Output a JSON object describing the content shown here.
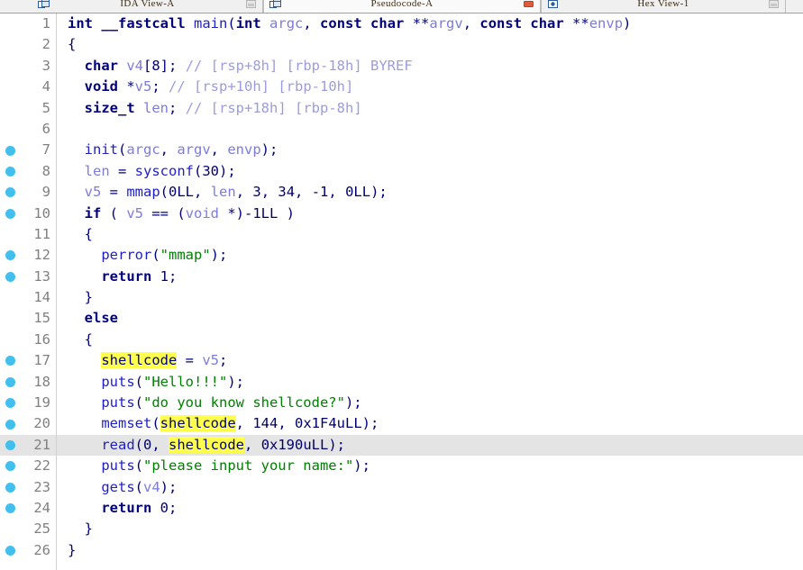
{
  "tabs": [
    {
      "label": "IDA View-A",
      "active": false,
      "icon": "window-icon",
      "button": "restore-icon",
      "button_color": "#c8c8c8"
    },
    {
      "label": "Pseudocode-A",
      "active": true,
      "icon": "window-icon",
      "button": "close-icon",
      "button_color": "#e05a3c"
    },
    {
      "label": "Hex View-1",
      "active": false,
      "icon": "hexview-icon",
      "button": "restore-icon",
      "button_color": "#c8c8c8"
    }
  ],
  "editor": {
    "highlight_word": "shellcode",
    "cursor_line": 21,
    "colors": {
      "breakpoint": "#41c0ef",
      "highlight_bg": "#ffff4d",
      "cursor_row_bg": "#e4e4e4",
      "string": "#008000",
      "comment": "#9c9cdc",
      "variable": "#7c7cdc",
      "function": "#2020c8",
      "keyword": "#00007f",
      "linenumber": "#808080"
    },
    "lines": [
      {
        "n": 1,
        "bp": false,
        "tokens": [
          {
            "c": "t-kw",
            "t": "int"
          },
          {
            "c": "t-plain",
            "t": " "
          },
          {
            "c": "t-kw",
            "t": "__fastcall"
          },
          {
            "c": "t-plain",
            "t": " "
          },
          {
            "c": "t-fn",
            "t": "main"
          },
          {
            "c": "t-punct",
            "t": "("
          },
          {
            "c": "t-kw",
            "t": "int"
          },
          {
            "c": "t-plain",
            "t": " "
          },
          {
            "c": "t-var",
            "t": "argc"
          },
          {
            "c": "t-punct",
            "t": ", "
          },
          {
            "c": "t-kw",
            "t": "const"
          },
          {
            "c": "t-plain",
            "t": " "
          },
          {
            "c": "t-kw",
            "t": "char"
          },
          {
            "c": "t-plain",
            "t": " **"
          },
          {
            "c": "t-var",
            "t": "argv"
          },
          {
            "c": "t-punct",
            "t": ", "
          },
          {
            "c": "t-kw",
            "t": "const"
          },
          {
            "c": "t-plain",
            "t": " "
          },
          {
            "c": "t-kw",
            "t": "char"
          },
          {
            "c": "t-plain",
            "t": " **"
          },
          {
            "c": "t-var",
            "t": "envp"
          },
          {
            "c": "t-punct",
            "t": ")"
          }
        ]
      },
      {
        "n": 2,
        "bp": false,
        "tokens": [
          {
            "c": "t-punct",
            "t": "{"
          }
        ]
      },
      {
        "n": 3,
        "bp": false,
        "tokens": [
          {
            "c": "t-plain",
            "t": "  "
          },
          {
            "c": "t-kw",
            "t": "char"
          },
          {
            "c": "t-plain",
            "t": " "
          },
          {
            "c": "t-var",
            "t": "v4"
          },
          {
            "c": "t-punct",
            "t": "[8]; "
          },
          {
            "c": "t-cmt",
            "t": "// [rsp+8h] [rbp-18h] BYREF"
          }
        ]
      },
      {
        "n": 4,
        "bp": false,
        "tokens": [
          {
            "c": "t-plain",
            "t": "  "
          },
          {
            "c": "t-kw",
            "t": "void"
          },
          {
            "c": "t-plain",
            "t": " *"
          },
          {
            "c": "t-var",
            "t": "v5"
          },
          {
            "c": "t-punct",
            "t": "; "
          },
          {
            "c": "t-cmt",
            "t": "// [rsp+10h] [rbp-10h]"
          }
        ]
      },
      {
        "n": 5,
        "bp": false,
        "tokens": [
          {
            "c": "t-plain",
            "t": "  "
          },
          {
            "c": "t-kw",
            "t": "size_t"
          },
          {
            "c": "t-plain",
            "t": " "
          },
          {
            "c": "t-var",
            "t": "len"
          },
          {
            "c": "t-punct",
            "t": "; "
          },
          {
            "c": "t-cmt",
            "t": "// [rsp+18h] [rbp-8h]"
          }
        ]
      },
      {
        "n": 6,
        "bp": false,
        "tokens": [
          {
            "c": "t-plain",
            "t": ""
          }
        ]
      },
      {
        "n": 7,
        "bp": true,
        "tokens": [
          {
            "c": "t-plain",
            "t": "  "
          },
          {
            "c": "t-fn",
            "t": "init"
          },
          {
            "c": "t-punct",
            "t": "("
          },
          {
            "c": "t-var",
            "t": "argc"
          },
          {
            "c": "t-punct",
            "t": ", "
          },
          {
            "c": "t-var",
            "t": "argv"
          },
          {
            "c": "t-punct",
            "t": ", "
          },
          {
            "c": "t-var",
            "t": "envp"
          },
          {
            "c": "t-punct",
            "t": ");"
          }
        ]
      },
      {
        "n": 8,
        "bp": true,
        "tokens": [
          {
            "c": "t-plain",
            "t": "  "
          },
          {
            "c": "t-var",
            "t": "len"
          },
          {
            "c": "t-plain",
            "t": " = "
          },
          {
            "c": "t-fn",
            "t": "sysconf"
          },
          {
            "c": "t-punct",
            "t": "("
          },
          {
            "c": "t-num",
            "t": "30"
          },
          {
            "c": "t-punct",
            "t": ");"
          }
        ]
      },
      {
        "n": 9,
        "bp": true,
        "tokens": [
          {
            "c": "t-plain",
            "t": "  "
          },
          {
            "c": "t-var",
            "t": "v5"
          },
          {
            "c": "t-plain",
            "t": " = "
          },
          {
            "c": "t-fn",
            "t": "mmap"
          },
          {
            "c": "t-punct",
            "t": "("
          },
          {
            "c": "t-num",
            "t": "0LL"
          },
          {
            "c": "t-punct",
            "t": ", "
          },
          {
            "c": "t-var",
            "t": "len"
          },
          {
            "c": "t-punct",
            "t": ", "
          },
          {
            "c": "t-num",
            "t": "3"
          },
          {
            "c": "t-punct",
            "t": ", "
          },
          {
            "c": "t-num",
            "t": "34"
          },
          {
            "c": "t-punct",
            "t": ", "
          },
          {
            "c": "t-num",
            "t": "-1"
          },
          {
            "c": "t-punct",
            "t": ", "
          },
          {
            "c": "t-num",
            "t": "0LL"
          },
          {
            "c": "t-punct",
            "t": ");"
          }
        ]
      },
      {
        "n": 10,
        "bp": true,
        "tokens": [
          {
            "c": "t-plain",
            "t": "  "
          },
          {
            "c": "t-kw",
            "t": "if"
          },
          {
            "c": "t-plain",
            "t": " ( "
          },
          {
            "c": "t-var",
            "t": "v5"
          },
          {
            "c": "t-plain",
            "t": " == ("
          },
          {
            "c": "t-var",
            "t": "void"
          },
          {
            "c": "t-plain",
            "t": " *)"
          },
          {
            "c": "t-num",
            "t": "-1LL"
          },
          {
            "c": "t-plain",
            "t": " )"
          }
        ]
      },
      {
        "n": 11,
        "bp": false,
        "tokens": [
          {
            "c": "t-plain",
            "t": "  "
          },
          {
            "c": "t-punct",
            "t": "{"
          }
        ]
      },
      {
        "n": 12,
        "bp": true,
        "tokens": [
          {
            "c": "t-plain",
            "t": "    "
          },
          {
            "c": "t-fn",
            "t": "perror"
          },
          {
            "c": "t-punct",
            "t": "("
          },
          {
            "c": "t-str",
            "t": "\"mmap\""
          },
          {
            "c": "t-punct",
            "t": ");"
          }
        ]
      },
      {
        "n": 13,
        "bp": true,
        "tokens": [
          {
            "c": "t-plain",
            "t": "    "
          },
          {
            "c": "t-kw",
            "t": "return"
          },
          {
            "c": "t-plain",
            "t": " "
          },
          {
            "c": "t-num",
            "t": "1"
          },
          {
            "c": "t-punct",
            "t": ";"
          }
        ]
      },
      {
        "n": 14,
        "bp": false,
        "tokens": [
          {
            "c": "t-plain",
            "t": "  "
          },
          {
            "c": "t-punct",
            "t": "}"
          }
        ]
      },
      {
        "n": 15,
        "bp": false,
        "tokens": [
          {
            "c": "t-plain",
            "t": "  "
          },
          {
            "c": "t-kw",
            "t": "else"
          }
        ]
      },
      {
        "n": 16,
        "bp": false,
        "tokens": [
          {
            "c": "t-plain",
            "t": "  "
          },
          {
            "c": "t-punct",
            "t": "{"
          }
        ]
      },
      {
        "n": 17,
        "bp": true,
        "tokens": [
          {
            "c": "t-plain",
            "t": "    "
          },
          {
            "c": "t-hl",
            "t": "shellcode"
          },
          {
            "c": "t-plain",
            "t": " = "
          },
          {
            "c": "t-var",
            "t": "v5"
          },
          {
            "c": "t-punct",
            "t": ";"
          }
        ]
      },
      {
        "n": 18,
        "bp": true,
        "tokens": [
          {
            "c": "t-plain",
            "t": "    "
          },
          {
            "c": "t-fn",
            "t": "puts"
          },
          {
            "c": "t-punct",
            "t": "("
          },
          {
            "c": "t-str",
            "t": "\"Hello!!!\""
          },
          {
            "c": "t-punct",
            "t": ");"
          }
        ]
      },
      {
        "n": 19,
        "bp": true,
        "tokens": [
          {
            "c": "t-plain",
            "t": "    "
          },
          {
            "c": "t-fn",
            "t": "puts"
          },
          {
            "c": "t-punct",
            "t": "("
          },
          {
            "c": "t-str",
            "t": "\"do you know shellcode?\""
          },
          {
            "c": "t-punct",
            "t": ");"
          }
        ]
      },
      {
        "n": 20,
        "bp": true,
        "tokens": [
          {
            "c": "t-plain",
            "t": "    "
          },
          {
            "c": "t-fn",
            "t": "memset"
          },
          {
            "c": "t-punct",
            "t": "("
          },
          {
            "c": "t-hl",
            "t": "shellcode"
          },
          {
            "c": "t-punct",
            "t": ", "
          },
          {
            "c": "t-num",
            "t": "144"
          },
          {
            "c": "t-punct",
            "t": ", "
          },
          {
            "c": "t-num",
            "t": "0x1F4uLL"
          },
          {
            "c": "t-punct",
            "t": ");"
          }
        ]
      },
      {
        "n": 21,
        "bp": true,
        "tokens": [
          {
            "c": "t-plain",
            "t": "    "
          },
          {
            "c": "t-fn",
            "t": "read"
          },
          {
            "c": "t-punct",
            "t": "("
          },
          {
            "c": "t-num",
            "t": "0"
          },
          {
            "c": "t-punct",
            "t": ", "
          },
          {
            "c": "t-hl",
            "t": "shellcode"
          },
          {
            "c": "t-punct",
            "t": ", "
          },
          {
            "c": "t-num",
            "t": "0x190uLL"
          },
          {
            "c": "t-punct",
            "t": ");"
          }
        ]
      },
      {
        "n": 22,
        "bp": true,
        "tokens": [
          {
            "c": "t-plain",
            "t": "    "
          },
          {
            "c": "t-fn",
            "t": "puts"
          },
          {
            "c": "t-punct",
            "t": "("
          },
          {
            "c": "t-str",
            "t": "\"please input your name:\""
          },
          {
            "c": "t-punct",
            "t": ");"
          }
        ]
      },
      {
        "n": 23,
        "bp": true,
        "tokens": [
          {
            "c": "t-plain",
            "t": "    "
          },
          {
            "c": "t-fn",
            "t": "gets"
          },
          {
            "c": "t-punct",
            "t": "("
          },
          {
            "c": "t-var",
            "t": "v4"
          },
          {
            "c": "t-punct",
            "t": ");"
          }
        ]
      },
      {
        "n": 24,
        "bp": true,
        "tokens": [
          {
            "c": "t-plain",
            "t": "    "
          },
          {
            "c": "t-kw",
            "t": "return"
          },
          {
            "c": "t-plain",
            "t": " "
          },
          {
            "c": "t-num",
            "t": "0"
          },
          {
            "c": "t-punct",
            "t": ";"
          }
        ]
      },
      {
        "n": 25,
        "bp": false,
        "tokens": [
          {
            "c": "t-plain",
            "t": "  "
          },
          {
            "c": "t-punct",
            "t": "}"
          }
        ]
      },
      {
        "n": 26,
        "bp": true,
        "tokens": [
          {
            "c": "t-punct",
            "t": "}"
          }
        ]
      }
    ]
  }
}
